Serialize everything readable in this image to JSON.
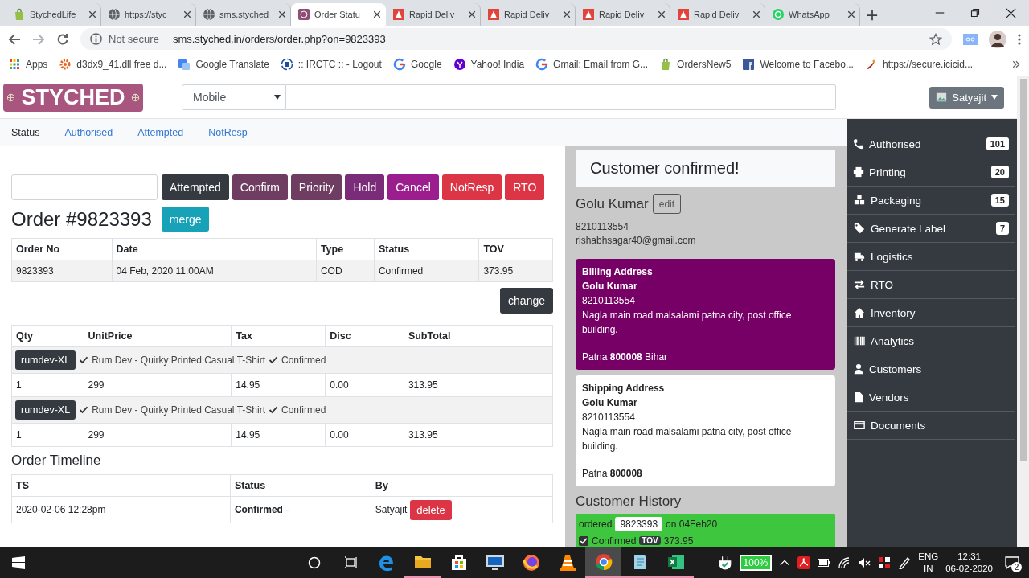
{
  "browser": {
    "tabs": [
      {
        "title": "StychedLife",
        "kind": "shop",
        "selected": false
      },
      {
        "title": "https://styc",
        "kind": "globe",
        "selected": false
      },
      {
        "title": "sms.styched",
        "kind": "globe",
        "selected": false
      },
      {
        "title": "Order Statu",
        "kind": "site",
        "selected": true
      },
      {
        "title": "Rapid Deliv",
        "kind": "pdf",
        "selected": false
      },
      {
        "title": "Rapid Deliv",
        "kind": "pdf",
        "selected": false
      },
      {
        "title": "Rapid Deliv",
        "kind": "pdf",
        "selected": false
      },
      {
        "title": "Rapid Deliv",
        "kind": "pdf",
        "selected": false
      },
      {
        "title": "WhatsApp",
        "kind": "chat",
        "selected": false
      }
    ],
    "security": "Not secure",
    "url": "sms.styched.in/orders/order.php?on=9823393",
    "bookmarks": [
      {
        "label": "Apps",
        "kind": "grid"
      },
      {
        "label": "d3dx9_41.dll free d...",
        "kind": "gear"
      },
      {
        "label": "Google Translate",
        "kind": "translate"
      },
      {
        "label": ":: IRCTC :: - Logout",
        "kind": "rail"
      },
      {
        "label": "Google",
        "kind": "google"
      },
      {
        "label": "Yahoo! India",
        "kind": "yahoo"
      },
      {
        "label": "Gmail: Email from G...",
        "kind": "google"
      },
      {
        "label": "OrdersNew5",
        "kind": "shop"
      },
      {
        "label": "Welcome to Facebo...",
        "kind": "facebook"
      },
      {
        "label": "https://secure.icicid...",
        "kind": "swoosh"
      }
    ]
  },
  "header": {
    "logo": "STYCHED",
    "search_type": "Mobile",
    "user": "Satyajit"
  },
  "subnav": [
    {
      "label": "Status",
      "selected": true
    },
    {
      "label": "Authorised",
      "selected": false
    },
    {
      "label": "Attempted",
      "selected": false
    },
    {
      "label": "NotResp",
      "selected": false
    }
  ],
  "actions": [
    {
      "label": "Attempted",
      "color": "#343a40"
    },
    {
      "label": "Confirm",
      "color": "#6e3d61"
    },
    {
      "label": "Priority",
      "color": "#6e3d61"
    },
    {
      "label": "Hold",
      "color": "#7b2c79"
    },
    {
      "label": "Cancel",
      "color": "#9b1d8e"
    },
    {
      "label": "NotResp",
      "color": "#dc3545"
    },
    {
      "label": "RTO",
      "color": "#dc3545"
    }
  ],
  "order": {
    "title": "Order #9823393",
    "merge": "merge",
    "columns": [
      "Order No",
      "Date",
      "Type",
      "Status",
      "TOV"
    ],
    "rows": [
      [
        "9823393",
        "04 Feb, 2020 11:00AM",
        "COD",
        "Confirmed",
        "373.95"
      ]
    ],
    "change": "change"
  },
  "items": {
    "columns": [
      "Qty",
      "UnitPrice",
      "Tax",
      "Disc",
      "SubTotal"
    ],
    "rows": [
      {
        "sku": "rumdev-XL",
        "product": "Rum Dev - Quirky Printed Casual T-Shirt",
        "status": "Confirmed",
        "values": [
          "1",
          "299",
          "14.95",
          "0.00",
          "313.95"
        ]
      },
      {
        "sku": "rumdev-XL",
        "product": "Rum Dev - Quirky Printed Casual T-Shirt",
        "status": "Confirmed",
        "values": [
          "1",
          "299",
          "14.95",
          "0.00",
          "313.95"
        ]
      }
    ]
  },
  "timeline": {
    "title": "Order Timeline",
    "columns": [
      "TS",
      "Status",
      "By"
    ],
    "rows": [
      {
        "ts": "2020-02-06 12:28pm",
        "status": "**Confirmed** -",
        "by": "Satyajit",
        "action": "delete"
      }
    ]
  },
  "customer": {
    "banner": "Customer confirmed!",
    "name": "Golu Kumar",
    "edit": "edit",
    "phone": "8210113554",
    "email": "rishabhsagar40@gmail.com",
    "addresses": [
      {
        "kind": "billing",
        "title": "Billing Address",
        "name": "Golu Kumar",
        "phone": "8210113554",
        "address": "Nagla main road malsalami patna city, post office building.",
        "city": "Patna **800008** Bihar"
      },
      {
        "kind": "shipping",
        "title": "Shipping Address",
        "name": "Golu Kumar",
        "phone": "8210113554",
        "address": "Nagla main road malsalami patna city, post office building.",
        "city": "Patna **800008**"
      }
    ],
    "history": {
      "title": "Customer History",
      "orders": [
        {
          "prefix": "ordered",
          "order_no": "9823393",
          "date": "on 04Feb20",
          "checked": true,
          "status": "Confirmed",
          "tag": "TOV",
          "total": "373.95"
        }
      ]
    }
  },
  "sidebar": [
    {
      "label": "Authorised",
      "kind": "phone",
      "count": "101"
    },
    {
      "label": "Printing",
      "kind": "printer",
      "count": "20"
    },
    {
      "label": "Packaging",
      "kind": "boxes",
      "count": "15"
    },
    {
      "label": "Generate Label",
      "kind": "tag",
      "count": "7"
    },
    {
      "label": "Logistics",
      "kind": "truck"
    },
    {
      "label": "RTO",
      "kind": "arrows"
    },
    {
      "label": "Inventory",
      "kind": "house"
    },
    {
      "label": "Analytics",
      "kind": "barcode"
    },
    {
      "label": "Customers",
      "kind": "user"
    },
    {
      "label": "Vendors",
      "kind": "file"
    },
    {
      "label": "Documents",
      "kind": "card"
    }
  ],
  "taskbar": {
    "apps": [
      {
        "kind": "edge",
        "running": false,
        "selected": false
      },
      {
        "kind": "folder",
        "running": true,
        "selected": false
      },
      {
        "kind": "store",
        "running": false,
        "selected": false
      },
      {
        "kind": "monitor",
        "running": false,
        "selected": false
      },
      {
        "kind": "firefox",
        "running": false,
        "selected": false
      },
      {
        "kind": "cone",
        "running": false,
        "selected": false
      },
      {
        "kind": "chrome",
        "running": true,
        "selected": true
      },
      {
        "kind": "notebook",
        "running": true,
        "selected": false
      },
      {
        "kind": "sheet",
        "running": true,
        "selected": false
      }
    ],
    "battery": "100%",
    "language": [
      "ENG",
      "IN"
    ],
    "time": "12:31",
    "date": "06-02-2020",
    "notifications": "2"
  }
}
